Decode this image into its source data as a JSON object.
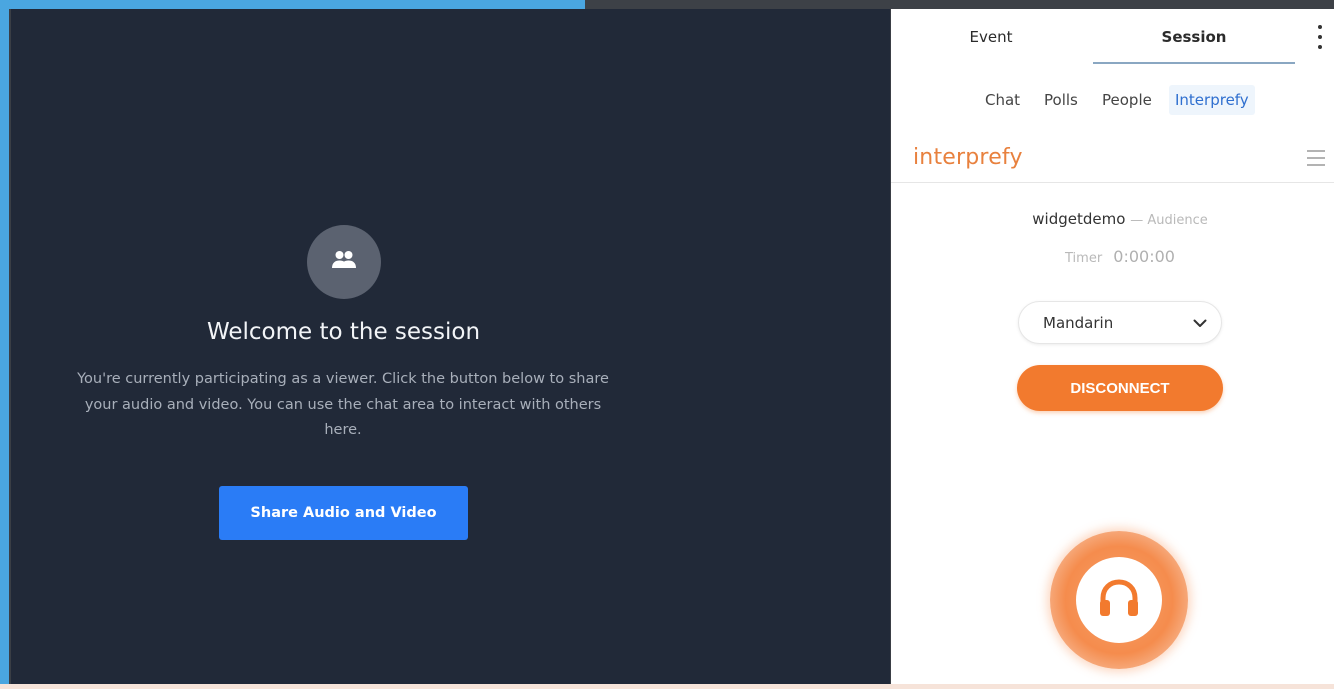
{
  "stage": {
    "title": "Welcome to the session",
    "description": "You're currently participating as a viewer. Click the button below to share your audio and video. You can use the chat area to interact with others here.",
    "share_button": "Share Audio and Video",
    "avatar_icon": "people-icon"
  },
  "panel": {
    "tabs": [
      "Event",
      "Session"
    ],
    "active_tab": "Session",
    "sub_tabs": [
      "Chat",
      "Polls",
      "People",
      "Interprefy"
    ],
    "active_sub_tab": "Interprefy",
    "brand": "interprefy",
    "room": "widgetdemo",
    "role": "— Audience",
    "timer_label": "Timer",
    "timer_value": "0:00:00",
    "language": "Mandarin",
    "disconnect": "DISCONNECT",
    "menu_icon": "hamburger-icon",
    "more_icon": "kebab-icon",
    "headset_icon": "headphones-icon"
  },
  "colors": {
    "accent_orange": "#f27a2e",
    "share_blue": "#2a7cf6",
    "stage_bg": "#212938",
    "frame_accent": "#4aa6e0"
  }
}
